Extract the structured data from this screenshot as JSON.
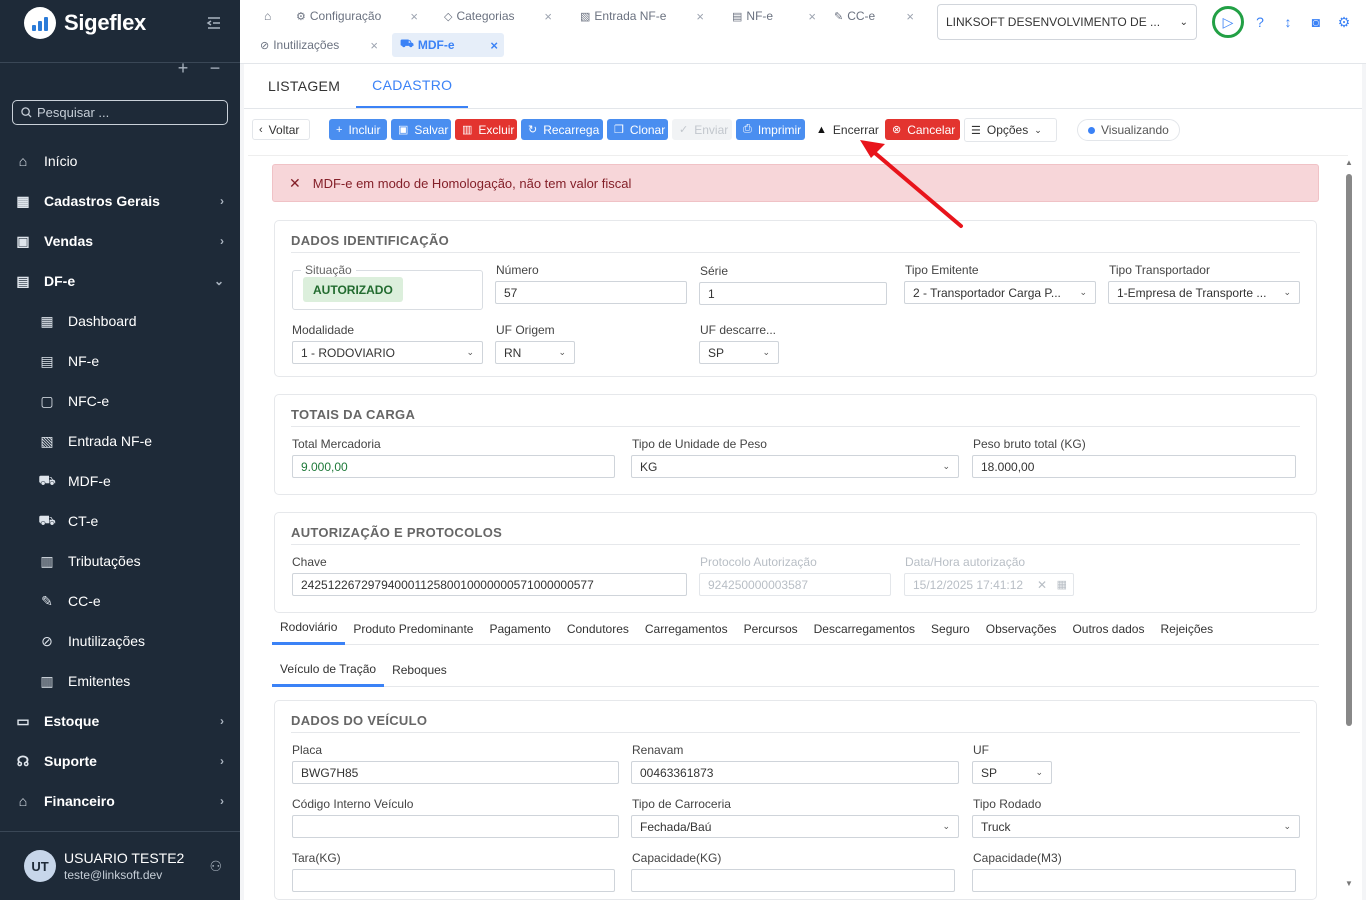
{
  "app": {
    "name": "Sigeflex"
  },
  "sidebar": {
    "search_placeholder": "Pesquisar ...",
    "items": [
      {
        "label": "Início",
        "icon": "home-icon",
        "type": "link"
      },
      {
        "label": "Cadastros Gerais",
        "icon": "grid-icon",
        "type": "group"
      },
      {
        "label": "Vendas",
        "icon": "cart-icon",
        "type": "group"
      },
      {
        "label": "DF-e",
        "icon": "document-icon",
        "type": "group",
        "expanded": true
      },
      {
        "label": "Dashboard",
        "icon": "dashboard-icon",
        "type": "sub"
      },
      {
        "label": "NF-e",
        "icon": "file-icon",
        "type": "sub"
      },
      {
        "label": "NFC-e",
        "icon": "receipt-icon",
        "type": "sub"
      },
      {
        "label": "Entrada NF-e",
        "icon": "file-download-icon",
        "type": "sub"
      },
      {
        "label": "MDF-e",
        "icon": "truck-icon",
        "type": "sub"
      },
      {
        "label": "CT-e",
        "icon": "truck-icon",
        "type": "sub"
      },
      {
        "label": "Tributações",
        "icon": "calculator-icon",
        "type": "sub"
      },
      {
        "label": "CC-e",
        "icon": "edit-file-icon",
        "type": "sub"
      },
      {
        "label": "Inutilizações",
        "icon": "ban-icon",
        "type": "sub"
      },
      {
        "label": "Emitentes",
        "icon": "building-icon",
        "type": "sub"
      },
      {
        "label": "Estoque",
        "icon": "box-icon",
        "type": "group"
      },
      {
        "label": "Suporte",
        "icon": "headset-icon",
        "type": "group"
      },
      {
        "label": "Financeiro",
        "icon": "bank-icon",
        "type": "group"
      }
    ],
    "user": {
      "initials": "UT",
      "name": "USUARIO TESTE2",
      "email": "teste@linksoft.dev"
    }
  },
  "header": {
    "tabs": [
      {
        "label": "Configuração",
        "icon": "gear-icon"
      },
      {
        "label": "Categorias",
        "icon": "tag-icon"
      },
      {
        "label": "Entrada NF-e",
        "icon": "file-download-icon"
      },
      {
        "label": "NF-e",
        "icon": "file-icon"
      },
      {
        "label": "CC-e",
        "icon": "edit-file-icon"
      },
      {
        "label": "Inutilizações",
        "icon": "ban-icon"
      },
      {
        "label": "MDF-e",
        "icon": "truck-icon",
        "active": true
      }
    ],
    "company": "LINKSOFT DESENVOLVIMENTO DE ..."
  },
  "page": {
    "subtabs": [
      "LISTAGEM",
      "CADASTRO"
    ],
    "active_subtab": "CADASTRO",
    "toolbar": {
      "voltar": "Voltar",
      "incluir": "Incluir",
      "salvar": "Salvar",
      "excluir": "Excluir",
      "recarrega": "Recarrega",
      "clonar": "Clonar",
      "enviar": "Enviar",
      "imprimir": "Imprimir",
      "encerrar": "Encerrar",
      "cancelar": "Cancelar",
      "opcoes": "Opções",
      "status": "Visualizando"
    },
    "alert": "MDF-e em modo de Homologação, não tem valor fiscal",
    "identificacao": {
      "title": "DADOS IDENTIFICAÇÃO",
      "situacao_label": "Situação",
      "situacao": "AUTORIZADO",
      "numero_label": "Número",
      "numero": "57",
      "serie_label": "Série",
      "serie": "1",
      "tipo_emitente_label": "Tipo Emitente",
      "tipo_emitente": "2 - Transportador Carga P...",
      "tipo_transportador_label": "Tipo Transportador",
      "tipo_transportador": "1-Empresa de Transporte ...",
      "modalidade_label": "Modalidade",
      "modalidade": "1 - RODOVIARIO",
      "uf_origem_label": "UF Origem",
      "uf_origem": "RN",
      "uf_descarregamento_label": "UF descarre...",
      "uf_descarregamento": "SP"
    },
    "totais": {
      "title": "TOTAIS DA CARGA",
      "total_mercadoria_label": "Total Mercadoria",
      "total_mercadoria": "9.000,00",
      "tipo_unidade_label": "Tipo de Unidade de Peso",
      "tipo_unidade": "KG",
      "peso_bruto_label": "Peso bruto total (KG)",
      "peso_bruto": "18.000,00"
    },
    "autorizacao": {
      "title": "AUTORIZAÇÃO E PROTOCOLOS",
      "chave_label": "Chave",
      "chave": "24251226729794000112580010000000571000000577",
      "protocolo_label": "Protocolo Autorização",
      "protocolo": "924250000003587",
      "data_label": "Data/Hora autorização",
      "data": "15/12/2025 17:41:12"
    },
    "detail_tabs": [
      "Rodoviário",
      "Produto Predominante",
      "Pagamento",
      "Condutores",
      "Carregamentos",
      "Percursos",
      "Descarregamentos",
      "Seguro",
      "Observações",
      "Outros dados",
      "Rejeições"
    ],
    "vehicle_tabs": [
      "Veículo de Tração",
      "Reboques"
    ],
    "veiculo": {
      "title": "DADOS DO VEÍCULO",
      "placa_label": "Placa",
      "placa": "BWG7H85",
      "renavam_label": "Renavam",
      "renavam": "00463361873",
      "uf_label": "UF",
      "uf": "SP",
      "codigo_label": "Código Interno Veículo",
      "codigo": "",
      "carroceria_label": "Tipo de Carroceria",
      "carroceria": "Fechada/Baú",
      "rodado_label": "Tipo Rodado",
      "rodado": "Truck",
      "tara_label": "Tara(KG)",
      "capacidade_kg_label": "Capacidade(KG)",
      "capacidade_m3_label": "Capacidade(M3)"
    }
  },
  "colors": {
    "sidebar": "#1e2a38",
    "primary": "#4a8ef0",
    "danger": "#e3342f",
    "annotation_arrow": "#e8141b"
  }
}
